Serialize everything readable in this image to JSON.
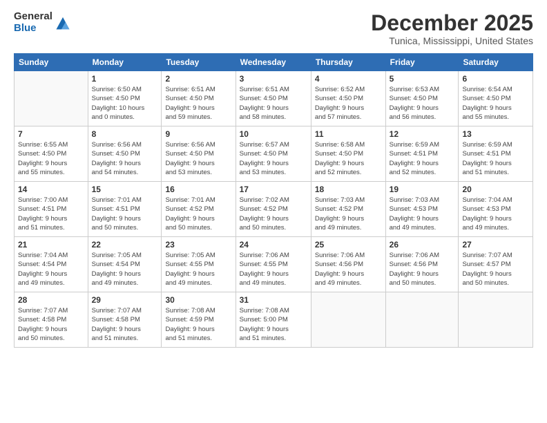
{
  "logo": {
    "general": "General",
    "blue": "Blue"
  },
  "title": "December 2025",
  "subtitle": "Tunica, Mississippi, United States",
  "weekdays": [
    "Sunday",
    "Monday",
    "Tuesday",
    "Wednesday",
    "Thursday",
    "Friday",
    "Saturday"
  ],
  "weeks": [
    [
      {
        "day": "",
        "info": ""
      },
      {
        "day": "1",
        "info": "Sunrise: 6:50 AM\nSunset: 4:50 PM\nDaylight: 10 hours\nand 0 minutes."
      },
      {
        "day": "2",
        "info": "Sunrise: 6:51 AM\nSunset: 4:50 PM\nDaylight: 9 hours\nand 59 minutes."
      },
      {
        "day": "3",
        "info": "Sunrise: 6:51 AM\nSunset: 4:50 PM\nDaylight: 9 hours\nand 58 minutes."
      },
      {
        "day": "4",
        "info": "Sunrise: 6:52 AM\nSunset: 4:50 PM\nDaylight: 9 hours\nand 57 minutes."
      },
      {
        "day": "5",
        "info": "Sunrise: 6:53 AM\nSunset: 4:50 PM\nDaylight: 9 hours\nand 56 minutes."
      },
      {
        "day": "6",
        "info": "Sunrise: 6:54 AM\nSunset: 4:50 PM\nDaylight: 9 hours\nand 55 minutes."
      }
    ],
    [
      {
        "day": "7",
        "info": "Sunrise: 6:55 AM\nSunset: 4:50 PM\nDaylight: 9 hours\nand 55 minutes."
      },
      {
        "day": "8",
        "info": "Sunrise: 6:56 AM\nSunset: 4:50 PM\nDaylight: 9 hours\nand 54 minutes."
      },
      {
        "day": "9",
        "info": "Sunrise: 6:56 AM\nSunset: 4:50 PM\nDaylight: 9 hours\nand 53 minutes."
      },
      {
        "day": "10",
        "info": "Sunrise: 6:57 AM\nSunset: 4:50 PM\nDaylight: 9 hours\nand 53 minutes."
      },
      {
        "day": "11",
        "info": "Sunrise: 6:58 AM\nSunset: 4:50 PM\nDaylight: 9 hours\nand 52 minutes."
      },
      {
        "day": "12",
        "info": "Sunrise: 6:59 AM\nSunset: 4:51 PM\nDaylight: 9 hours\nand 52 minutes."
      },
      {
        "day": "13",
        "info": "Sunrise: 6:59 AM\nSunset: 4:51 PM\nDaylight: 9 hours\nand 51 minutes."
      }
    ],
    [
      {
        "day": "14",
        "info": "Sunrise: 7:00 AM\nSunset: 4:51 PM\nDaylight: 9 hours\nand 51 minutes."
      },
      {
        "day": "15",
        "info": "Sunrise: 7:01 AM\nSunset: 4:51 PM\nDaylight: 9 hours\nand 50 minutes."
      },
      {
        "day": "16",
        "info": "Sunrise: 7:01 AM\nSunset: 4:52 PM\nDaylight: 9 hours\nand 50 minutes."
      },
      {
        "day": "17",
        "info": "Sunrise: 7:02 AM\nSunset: 4:52 PM\nDaylight: 9 hours\nand 50 minutes."
      },
      {
        "day": "18",
        "info": "Sunrise: 7:03 AM\nSunset: 4:52 PM\nDaylight: 9 hours\nand 49 minutes."
      },
      {
        "day": "19",
        "info": "Sunrise: 7:03 AM\nSunset: 4:53 PM\nDaylight: 9 hours\nand 49 minutes."
      },
      {
        "day": "20",
        "info": "Sunrise: 7:04 AM\nSunset: 4:53 PM\nDaylight: 9 hours\nand 49 minutes."
      }
    ],
    [
      {
        "day": "21",
        "info": "Sunrise: 7:04 AM\nSunset: 4:54 PM\nDaylight: 9 hours\nand 49 minutes."
      },
      {
        "day": "22",
        "info": "Sunrise: 7:05 AM\nSunset: 4:54 PM\nDaylight: 9 hours\nand 49 minutes."
      },
      {
        "day": "23",
        "info": "Sunrise: 7:05 AM\nSunset: 4:55 PM\nDaylight: 9 hours\nand 49 minutes."
      },
      {
        "day": "24",
        "info": "Sunrise: 7:06 AM\nSunset: 4:55 PM\nDaylight: 9 hours\nand 49 minutes."
      },
      {
        "day": "25",
        "info": "Sunrise: 7:06 AM\nSunset: 4:56 PM\nDaylight: 9 hours\nand 49 minutes."
      },
      {
        "day": "26",
        "info": "Sunrise: 7:06 AM\nSunset: 4:56 PM\nDaylight: 9 hours\nand 50 minutes."
      },
      {
        "day": "27",
        "info": "Sunrise: 7:07 AM\nSunset: 4:57 PM\nDaylight: 9 hours\nand 50 minutes."
      }
    ],
    [
      {
        "day": "28",
        "info": "Sunrise: 7:07 AM\nSunset: 4:58 PM\nDaylight: 9 hours\nand 50 minutes."
      },
      {
        "day": "29",
        "info": "Sunrise: 7:07 AM\nSunset: 4:58 PM\nDaylight: 9 hours\nand 51 minutes."
      },
      {
        "day": "30",
        "info": "Sunrise: 7:08 AM\nSunset: 4:59 PM\nDaylight: 9 hours\nand 51 minutes."
      },
      {
        "day": "31",
        "info": "Sunrise: 7:08 AM\nSunset: 5:00 PM\nDaylight: 9 hours\nand 51 minutes."
      },
      {
        "day": "",
        "info": ""
      },
      {
        "day": "",
        "info": ""
      },
      {
        "day": "",
        "info": ""
      }
    ]
  ]
}
